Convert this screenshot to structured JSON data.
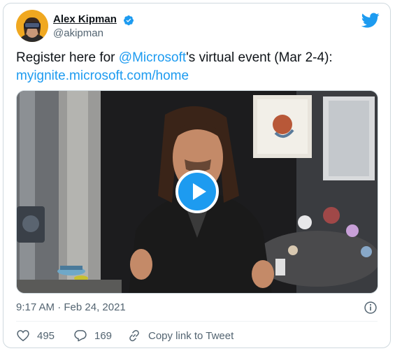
{
  "author": {
    "name": "Alex Kipman",
    "handle": "@akipman",
    "verified": true,
    "avatar_bg": "#f0a820"
  },
  "tweet": {
    "text_prefix": "Register here for ",
    "mention": "@Microsoft",
    "text_suffix": "'s virtual event (Mar 2-4):",
    "link": "myignite.microsoft.com/home"
  },
  "media": {
    "type": "video",
    "play_icon": "play-icon"
  },
  "meta": {
    "timestamp": "9:17 AM · Feb 24, 2021"
  },
  "actions": {
    "likes": "495",
    "replies": "169",
    "copy_link_label": "Copy link to Tweet"
  },
  "colors": {
    "accent": "#1d9bf0",
    "text": "#0f1419",
    "secondary": "#536471",
    "border": "#cfd9de"
  }
}
